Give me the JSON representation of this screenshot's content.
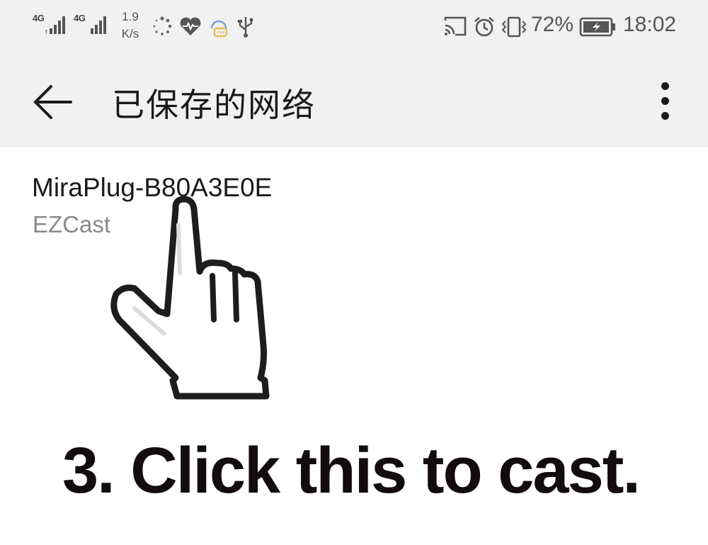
{
  "status_bar": {
    "sim1_label": "4G",
    "sim2_label": "4G",
    "speed_value": "1.9",
    "speed_unit": "K/s",
    "battery_percent": "72%",
    "time": "18:02",
    "left_icons": [
      "loading-dots-icon",
      "heart-rate-icon",
      "assistant-chat-icon",
      "usb-icon"
    ],
    "right_icons": [
      "cast-icon",
      "alarm-icon",
      "vibrate-icon",
      "battery-charging-icon"
    ]
  },
  "app_bar": {
    "title": "已保存的网络",
    "back_icon": "arrow-left-icon",
    "menu_icon": "more-vertical-icon"
  },
  "networks": [
    {
      "name": "MiraPlug-B80A3E0E",
      "subtitle": "EZCast"
    }
  ],
  "overlay": {
    "caption": "3. Click this to cast.",
    "pointer_icon": "pointing-hand-icon"
  },
  "colors": {
    "app_bar_bg": "#f1f1f1",
    "page_bg": "#ffffff",
    "primary_text": "#1a1a1a",
    "secondary_text": "#8a8a8a",
    "caption_text": "#120c0c"
  }
}
